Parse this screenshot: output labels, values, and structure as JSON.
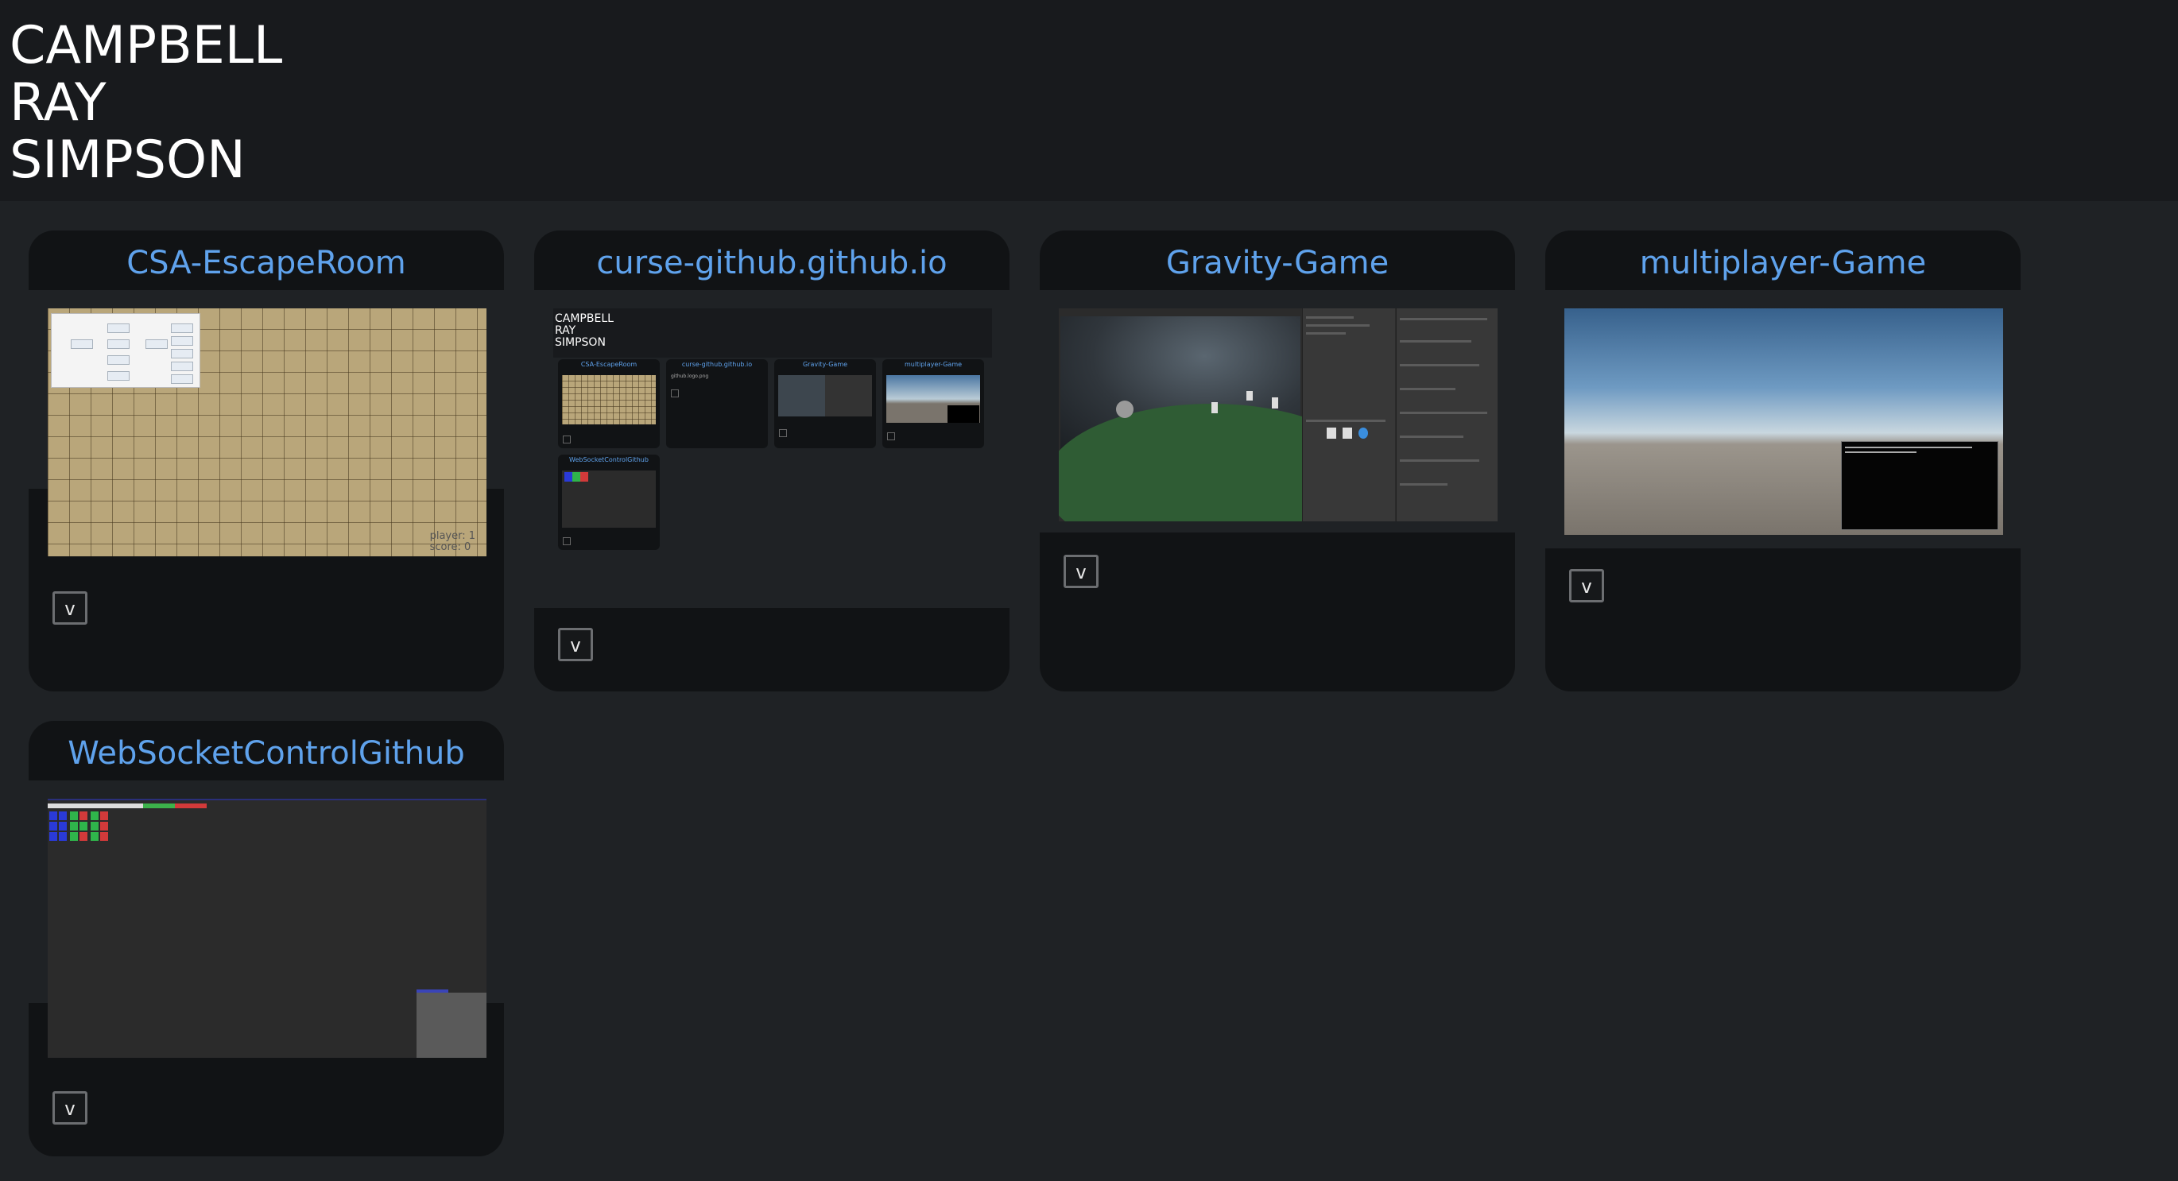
{
  "header": {
    "name_lines": [
      "CAMPBELL",
      "RAY",
      "SIMPSON"
    ]
  },
  "projects": [
    {
      "title": "CSA-EscapeRoom",
      "toggle_label": "v",
      "screenshot": {
        "hud_player": "player: 1",
        "hud_score": "score: 0"
      }
    },
    {
      "title": "curse-github.github.io",
      "toggle_label": "v",
      "screenshot": {
        "name_lines": [
          "CAMPBELL",
          "RAY",
          "SIMPSON"
        ],
        "cards": [
          "CSA-EscapeRoom",
          "curse-github.github.io",
          "Gravity-Game",
          "multiplayer-Game",
          "WebSocketControlGithub"
        ],
        "broken_image_text": "github.logo.png"
      }
    },
    {
      "title": "Gravity-Game",
      "toggle_label": "v"
    },
    {
      "title": "multiplayer-Game",
      "toggle_label": "v"
    },
    {
      "title": "WebSocketControlGithub",
      "toggle_label": "v"
    }
  ],
  "colors": {
    "background": "#1f2225",
    "header_bg": "#181a1d",
    "card_bg": "#111315",
    "link": "#5fa2ec"
  },
  "icons": [
    "toggle-icon"
  ]
}
